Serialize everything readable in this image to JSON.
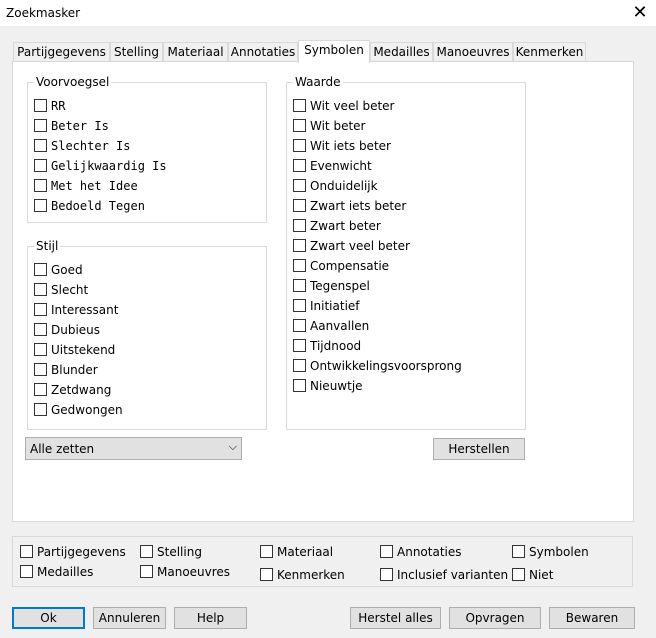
{
  "window": {
    "title": "Zoekmasker",
    "close_glyph": "✕"
  },
  "tabs": [
    "Partijgegevens",
    "Stelling",
    "Materiaal",
    "Annotaties",
    "Symbolen",
    "Medailles",
    "Manoeuvres",
    "Kenmerken"
  ],
  "active_tab": "Symbolen",
  "voorvoegsel": {
    "legend": "Voorvoegsel",
    "items": [
      "RR",
      "Beter Is",
      "Slechter Is",
      "Gelijkwaardig Is",
      "Met het Idee",
      "Bedoeld Tegen"
    ]
  },
  "stijl": {
    "legend": "Stijl",
    "items": [
      "Goed",
      "Slecht",
      "Interessant",
      "Dubieus",
      "Uitstekend",
      "Blunder",
      "Zetdwang",
      "Gedwongen"
    ]
  },
  "waarde": {
    "legend": "Waarde",
    "items": [
      "Wit veel beter",
      "Wit beter",
      "Wit iets beter",
      "Evenwicht",
      "Onduidelijk",
      "Zwart iets beter",
      "Zwart beter",
      "Zwart veel beter",
      "Compensatie",
      "Tegenspel",
      "Initiatief",
      "Aanvallen",
      "Tijdnood",
      "Ontwikkelingsvoorsprong",
      "Nieuwtje"
    ]
  },
  "moves_select": {
    "value": "Alle zetten",
    "arrow": "⌵"
  },
  "reset_button": "Herstellen",
  "search_sections": {
    "row1": [
      "Partijgegevens",
      "Stelling",
      "Materiaal",
      "Annotaties",
      "Symbolen"
    ],
    "row2": [
      "Medailles",
      "Manoeuvres",
      "Kenmerken",
      "Inclusief varianten",
      "Niet"
    ]
  },
  "buttons": {
    "ok": "Ok",
    "cancel": "Annuleren",
    "help": "Help",
    "reset_all": "Herstel alles",
    "query": "Opvragen",
    "save": "Bewaren"
  }
}
